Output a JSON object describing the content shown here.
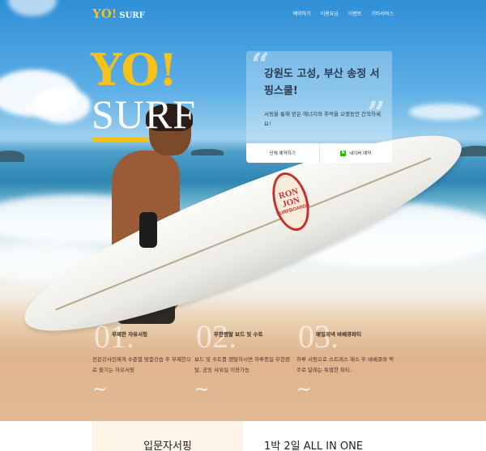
{
  "nav": {
    "logo_yo": "YO!",
    "logo_surf": "SURF",
    "menu": [
      "예약하기",
      "이용요금",
      "이벤트",
      "기타서비스"
    ]
  },
  "hero": {
    "title_line1": "YO!",
    "title_line2": "SURF",
    "board_brand_line1": "RON JON",
    "board_brand_line2": "SURFBOARDS"
  },
  "card": {
    "title": "강원도 고성, 부산 송정 서핑스쿨!",
    "description": "서핑을 통해 얻은 에너지와 추억을 오랫동안 간직하세요!",
    "group_button": "단체 예약하기",
    "naver_button": "네이버 예약",
    "naver_icon_letter": "N"
  },
  "features": [
    {
      "num": "01.",
      "label": "무제한 자유서핑",
      "desc": "전문강사진에게 수준별 맞춤강습 후 무제한으로 즐기는 자유서핑",
      "wave": "~"
    },
    {
      "num": "02.",
      "label": "무한렌탈 보드 및 수트",
      "desc": "보드 및 수트를 렌탈하시면 하루종일 무한렌탈, 공동 샤워실 이용가능",
      "wave": "~"
    },
    {
      "num": "03.",
      "label": "매일저녁 바베큐파티",
      "desc": "하루 서핑으로 스트레스 해소 후 바베큐와 맥주로 달래는 특별한 파티.",
      "wave": "~"
    }
  ],
  "tabs": {
    "left": "입문자서핑",
    "right": "1박 2일 ALL IN ONE"
  },
  "colors": {
    "accent_yellow": "#f6c218",
    "sand": "#e0b48e",
    "naver_green": "#2db400"
  }
}
